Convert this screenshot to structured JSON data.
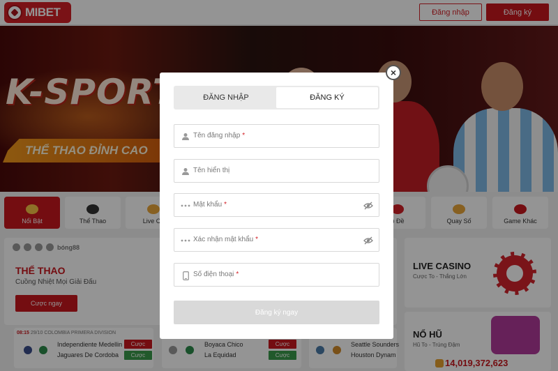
{
  "header": {
    "logo_text": "MIBET",
    "login_label": "Đăng nhập",
    "register_label": "Đăng ký"
  },
  "banner": {
    "headline": "K-SPORT",
    "ribbon": "THỂ THAO ĐỈNH CAO"
  },
  "categories": [
    {
      "label": "Nổi Bật",
      "icon": "crown-icon",
      "active": true
    },
    {
      "label": "Thể Thao",
      "icon": "soccer-ball-icon"
    },
    {
      "label": "Live Ca",
      "icon": "cards-icon"
    },
    {
      "label": "ô Đề",
      "icon": "lottery-balls-icon"
    },
    {
      "label": "Quay Số",
      "icon": "dice-icon"
    },
    {
      "label": "Game Khác",
      "icon": "rocket-icon"
    }
  ],
  "sport_panel": {
    "partner_text": "bóng88",
    "title": "THỂ THAO",
    "subtitle": "Cuồng Nhiệt Mọi Giải Đấu",
    "cta": "Cược ngay"
  },
  "matches": [
    {
      "time": "08:15",
      "date": "29/10",
      "league": "COLOMBIA PRIMERA DIVISION",
      "home": "Independiente Medellin",
      "away": "Jaguares De Cordoba"
    },
    {
      "home": "Boyaca Chico",
      "away": "La Equidad"
    },
    {
      "home": "Seattle Sounders",
      "away": "Houston Dynam"
    }
  ],
  "bet_labels": {
    "k": "Cược",
    "g": "Cược"
  },
  "live_casino": {
    "title": "LIVE CASINO",
    "subtitle": "Cược To - Thắng Lớn"
  },
  "no_hu": {
    "title": "NỔ HŨ",
    "subtitle": "Hũ To - Trúng Đậm",
    "jackpot": "14,019,372,623"
  },
  "modal": {
    "close_icon": "close-icon",
    "tabs": {
      "login": "ĐĂNG NHẬP",
      "register": "ĐĂNG KÝ",
      "active": "register"
    },
    "fields": {
      "username": {
        "placeholder": "Tên đăng nhập",
        "required": "*"
      },
      "display_name": {
        "placeholder": "Tên hiển thị",
        "required": ""
      },
      "password": {
        "placeholder": "Mật khẩu",
        "required": "*"
      },
      "confirm_password": {
        "placeholder": "Xác nhận mật khẩu",
        "required": "*"
      },
      "phone": {
        "placeholder": "Số điện thoại",
        "required": "*"
      }
    },
    "submit_label": "Đăng ký ngay"
  },
  "colors": {
    "brand_red": "#c8171e",
    "overlay": "rgba(0,0,0,0.42)",
    "disabled_button": "#d9d9d9"
  }
}
